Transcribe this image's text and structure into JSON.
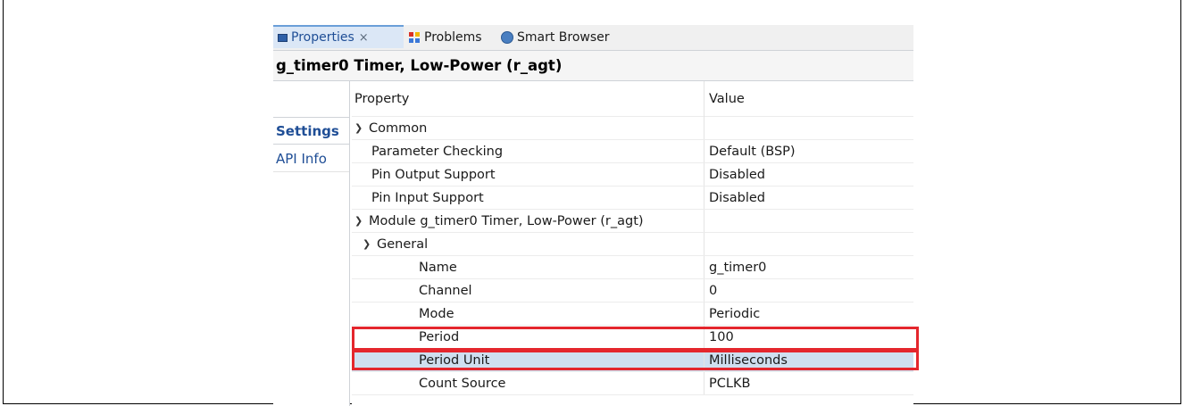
{
  "tabs": {
    "properties": "Properties",
    "problems": "Problems",
    "smart_browser": "Smart Browser"
  },
  "title": "g_timer0 Timer, Low-Power (r_agt)",
  "side_tabs": {
    "settings": "Settings",
    "api_info": "API Info"
  },
  "table": {
    "header_property": "Property",
    "header_value": "Value",
    "rows": [
      {
        "property": "Common",
        "value": ""
      },
      {
        "property": "Parameter Checking",
        "value": "Default (BSP)"
      },
      {
        "property": "Pin Output Support",
        "value": "Disabled"
      },
      {
        "property": "Pin Input Support",
        "value": "Disabled"
      },
      {
        "property": "Module g_timer0 Timer, Low-Power (r_agt)",
        "value": ""
      },
      {
        "property": "General",
        "value": ""
      },
      {
        "property": "Name",
        "value": "g_timer0"
      },
      {
        "property": "Channel",
        "value": "0"
      },
      {
        "property": "Mode",
        "value": "Periodic"
      },
      {
        "property": "Period",
        "value": "100"
      },
      {
        "property": "Period Unit",
        "value": "Milliseconds"
      },
      {
        "property": "Count Source",
        "value": "PCLKB"
      }
    ]
  },
  "colors": {
    "highlight": "#e4262d",
    "selection": "#cfdff0"
  }
}
